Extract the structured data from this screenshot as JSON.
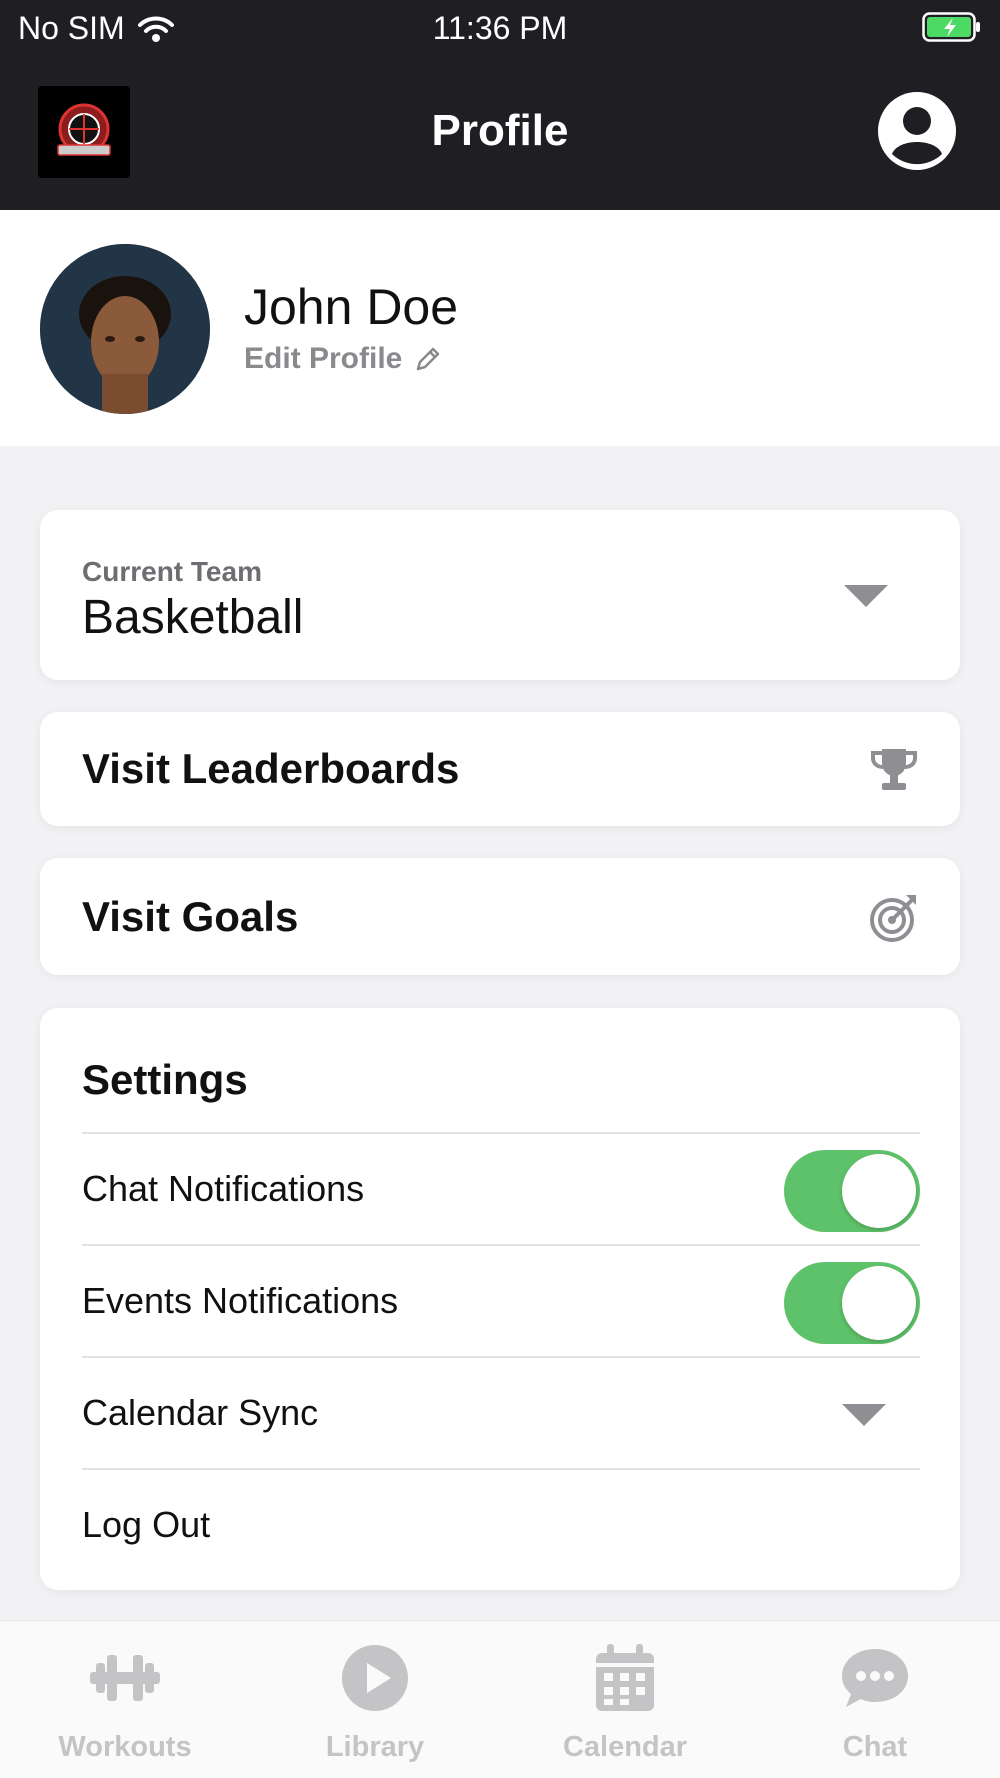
{
  "status_bar": {
    "carrier": "No SIM",
    "time": "11:36 PM"
  },
  "nav": {
    "title": "Profile",
    "logo_icon": "team-logo",
    "account_icon": "account-circle-icon"
  },
  "profile": {
    "name": "John Doe",
    "edit_label": "Edit Profile"
  },
  "team": {
    "label": "Current Team",
    "value": "Basketball"
  },
  "leaderboards": {
    "label": "Visit Leaderboards",
    "icon": "trophy-icon"
  },
  "goals": {
    "label": "Visit Goals",
    "icon": "target-icon"
  },
  "settings": {
    "title": "Settings",
    "items": [
      {
        "label": "Chat Notifications",
        "type": "toggle",
        "on": true
      },
      {
        "label": "Events Notifications",
        "type": "toggle",
        "on": true
      },
      {
        "label": "Calendar Sync",
        "type": "dropdown"
      },
      {
        "label": "Log Out",
        "type": "action"
      }
    ]
  },
  "tabbar": {
    "items": [
      {
        "label": "Workouts",
        "icon": "dumbbell-icon"
      },
      {
        "label": "Library",
        "icon": "play-circle-icon"
      },
      {
        "label": "Calendar",
        "icon": "calendar-icon"
      },
      {
        "label": "Chat",
        "icon": "chat-bubble-icon"
      }
    ]
  },
  "colors": {
    "topbar": "#1f1f23",
    "toggle_on": "#5ec26a",
    "inactive_tab": "#c4c4c7",
    "background": "#f2f2f4"
  }
}
